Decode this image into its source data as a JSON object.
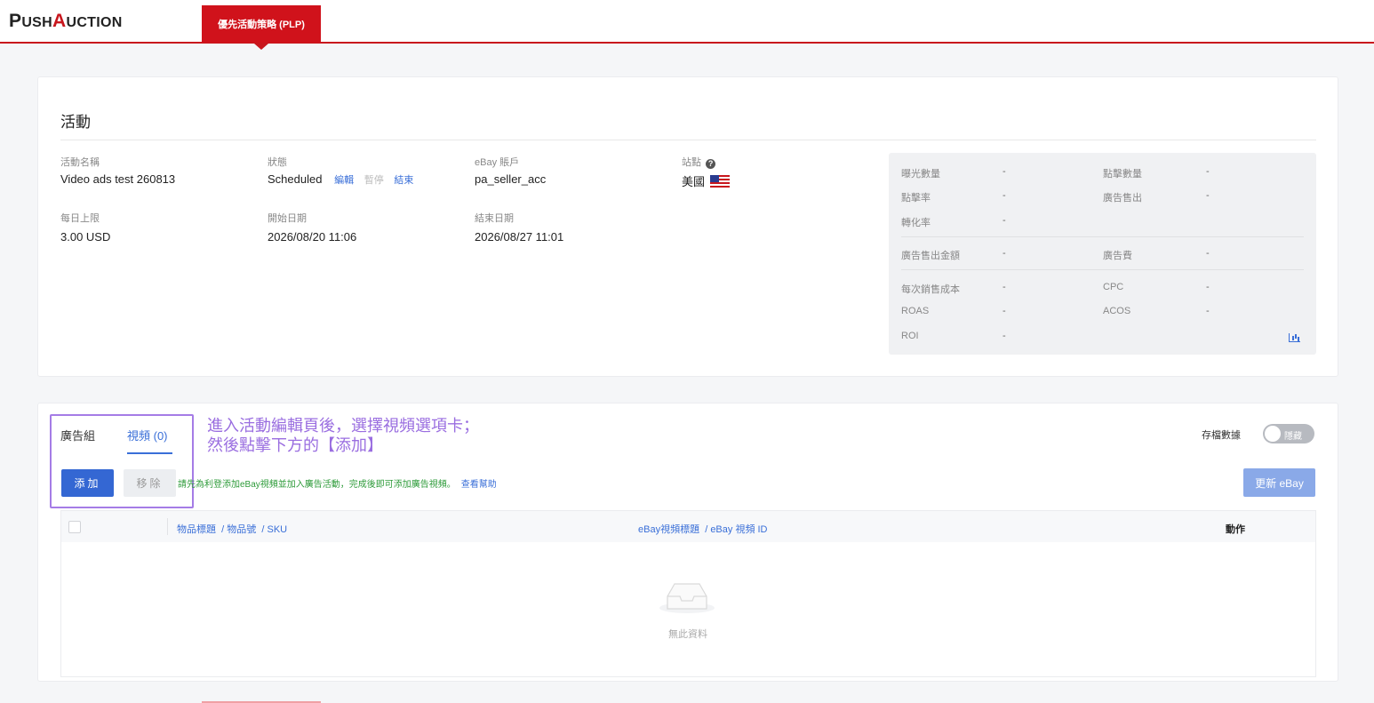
{
  "header": {
    "logo": {
      "p": "P",
      "ush": "USH",
      "a": "A",
      "uction": "UCTION"
    },
    "nav_tab": "優先活動策略 (PLP)"
  },
  "campaign": {
    "title": "活動",
    "name_label": "活動名稱",
    "name_value": "Video ads test 260813",
    "status_label": "狀態",
    "status_value": "Scheduled",
    "status_actions": {
      "edit": "編輯",
      "pause": "暫停",
      "end": "結束"
    },
    "account_label": "eBay 賬戶",
    "account_value": "pa_seller_acc",
    "site_label": "站點",
    "site_help_icon": "?",
    "site_value": "美國",
    "daily_limit_label": "每日上限",
    "daily_limit_value": "3.00 USD",
    "start_label": "開始日期",
    "start_value": "2026/08/20 11:06",
    "end_label": "結束日期",
    "end_value": "2026/08/27 11:01"
  },
  "stats": {
    "impressions_label": "曝光數量",
    "impressions_value": "-",
    "clicks_label": "點擊數量",
    "clicks_value": "-",
    "ctr_label": "點擊率",
    "ctr_value": "-",
    "ad_sales_label": "廣告售出",
    "ad_sales_value": "-",
    "conversion_label": "轉化率",
    "conversion_value": "-",
    "ad_revenue_label": "廣告售出金額",
    "ad_revenue_value": "-",
    "ad_fee_label": "廣告費",
    "ad_fee_value": "-",
    "cost_per_sale_label": "每次銷售成本",
    "cost_per_sale_value": "-",
    "cpc_label": "CPC",
    "cpc_value": "-",
    "roas_label": "ROAS",
    "roas_value": "-",
    "acos_label": "ACOS",
    "acos_value": "-",
    "roi_label": "ROI",
    "roi_value": "-"
  },
  "videos": {
    "tab_ad_groups": "廣告組",
    "tab_videos": "視頻 (0)",
    "annotation_line1": "進入活動編輯頁後，選擇視頻選項卡；",
    "annotation_line2": "然後點擊下方的【添加】",
    "add_button": "添加",
    "remove_button": "移除",
    "hint": "請先為利登添加eBay視頻並加入廣告活動，完成後即可添加廣告視頻。",
    "help_link": "查看幫助",
    "archive_label": "存檔數據",
    "toggle_text": "隱藏",
    "update_button": "更新 eBay",
    "columns": {
      "item_title": "物品標題",
      "item_no": "/ 物品號",
      "sku": "/ SKU",
      "video_title": "eBay視頻標題",
      "video_id": "/ eBay 視頻 ID",
      "actions": "動作"
    },
    "empty_text": "無此資料"
  }
}
